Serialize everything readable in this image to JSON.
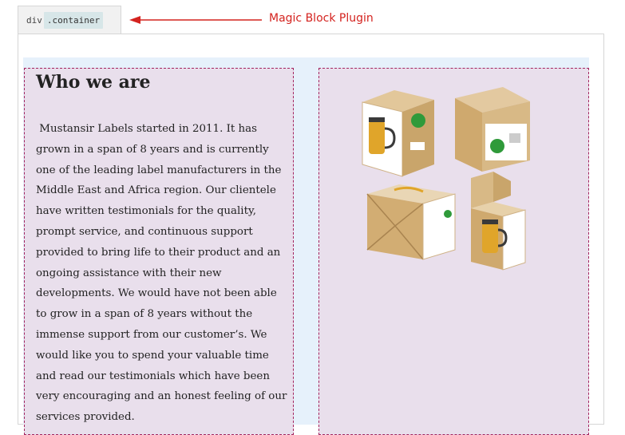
{
  "tab": {
    "tag": "div",
    "class_chip": ".container"
  },
  "annotation": {
    "label": "Magic Block Plugin",
    "color": "#d4231f"
  },
  "content": {
    "heading": "Who we are",
    "paragraph": " Mustansir Labels started in 2011. It has grown in a span of 8 years and is currently one of the leading label manufacturers in the Middle East and Africa region. Our clientele have written testimonials for the quality, prompt service, and continuous support provided to bring life to their product and an ongoing assistance with their new developments. We would have not been able to grow in a span of 8 years without the immense support from our customer’s. We would like you to spend your valuable time and read our testimonials which have been very encouraging and an honest feeling of our services provided."
  },
  "image": {
    "subject": "mug-packaging-boxes"
  },
  "colors": {
    "container_background": "#e6f1fb",
    "column_background": "#e9dfec",
    "column_border": "#a3245f"
  }
}
